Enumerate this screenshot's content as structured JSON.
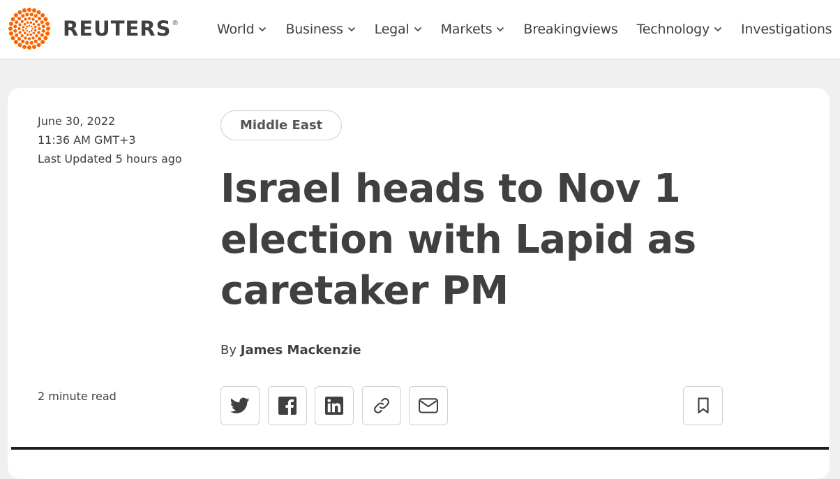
{
  "brand": {
    "name": "REUTERS",
    "registered": "®",
    "accent_color": "#fa6400"
  },
  "nav": {
    "items": [
      {
        "label": "World",
        "has_dropdown": true
      },
      {
        "label": "Business",
        "has_dropdown": true
      },
      {
        "label": "Legal",
        "has_dropdown": true
      },
      {
        "label": "Markets",
        "has_dropdown": true
      },
      {
        "label": "Breakingviews",
        "has_dropdown": false
      },
      {
        "label": "Technology",
        "has_dropdown": true
      },
      {
        "label": "Investigations",
        "has_dropdown": false
      }
    ]
  },
  "article": {
    "date": "June 30, 2022",
    "time": "11:36 AM GMT+3",
    "last_updated": "Last Updated 5 hours ago",
    "read_time": "2 minute read",
    "section_tag": "Middle East",
    "headline_lines": [
      "Israel heads to Nov 1",
      "election with Lapid as",
      "caretaker PM"
    ],
    "byline_prefix": "By",
    "author": "James Mackenzie"
  },
  "share": {
    "buttons": [
      {
        "icon": "twitter-icon"
      },
      {
        "icon": "facebook-icon"
      },
      {
        "icon": "linkedin-icon"
      },
      {
        "icon": "link-icon"
      },
      {
        "icon": "email-icon"
      }
    ],
    "bookmark_icon": "bookmark-icon"
  }
}
